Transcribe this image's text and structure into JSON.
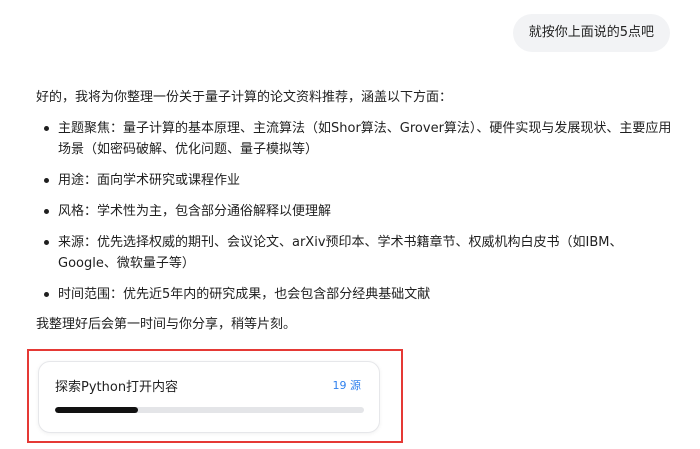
{
  "user_message": "就按你上面说的5点吧",
  "reply": {
    "intro": "好的，我将为你整理一份关于量子计算的论文资料推荐，涵盖以下方面：",
    "points": [
      "主题聚焦：量子计算的基本原理、主流算法（如Shor算法、Grover算法）、硬件实现与发展现状、主要应用场景（如密码破解、优化问题、量子模拟等）",
      "用途：面向学术研究或课程作业",
      "风格：学术性为主，包含部分通俗解释以便理解",
      "来源：优先选择权威的期刊、会议论文、arXiv预印本、学术书籍章节、权威机构白皮书（如IBM、Google、微软量子等）",
      "时间范围：优先近5年内的研究成果，也会包含部分经典基础文献"
    ],
    "outro": "我整理好后会第一时间与你分享，稍等片刻。"
  },
  "progress_card": {
    "title": "探索Python打开内容",
    "source_count": "19 源",
    "progress": 0.27
  },
  "colors": {
    "accent_blue": "#2f80ed",
    "highlight_red": "#e53935",
    "progress_fill": "#111111"
  }
}
